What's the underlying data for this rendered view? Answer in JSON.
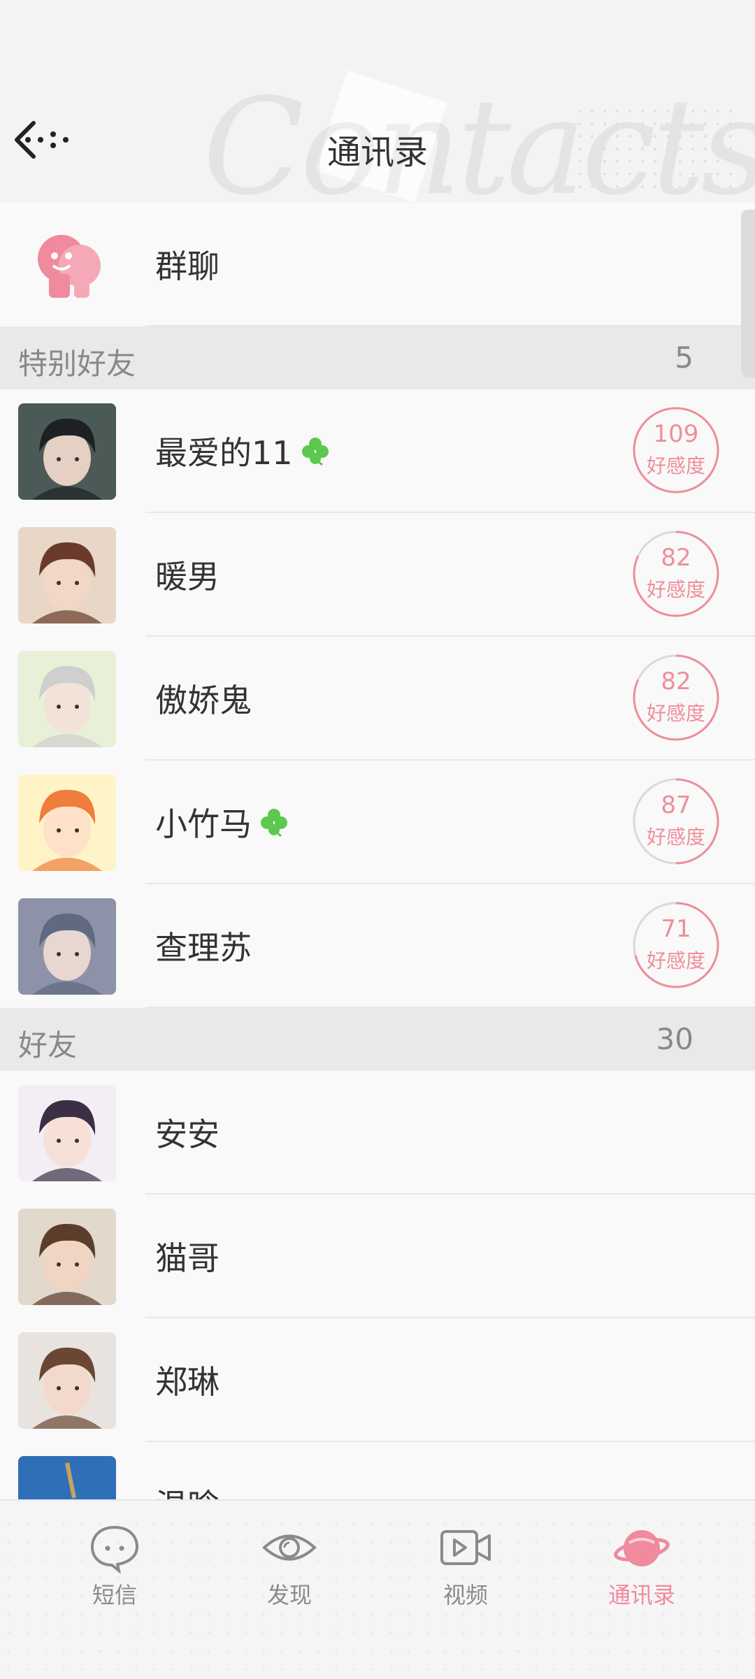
{
  "header": {
    "title": "通讯录",
    "background_word": "Contacts"
  },
  "group_chat": {
    "label": "群聊"
  },
  "special_friends": {
    "title": "特别好友",
    "count": "5",
    "items": [
      {
        "name": "最爱的11",
        "clover": true,
        "affinity": "109",
        "affinity_label": "好感度",
        "fraction": 1.0,
        "avatar": "avatar-dark-hair-man"
      },
      {
        "name": "暖男",
        "clover": false,
        "affinity": "82",
        "affinity_label": "好感度",
        "fraction": 0.82,
        "avatar": "avatar-glasses-man"
      },
      {
        "name": "傲娇鬼",
        "clover": false,
        "affinity": "82",
        "affinity_label": "好感度",
        "fraction": 0.82,
        "avatar": "avatar-silver-hair-man"
      },
      {
        "name": "小竹马",
        "clover": true,
        "affinity": "87",
        "affinity_label": "好感度",
        "fraction": 0.5,
        "avatar": "avatar-chibi-boy"
      },
      {
        "name": "查理苏",
        "clover": false,
        "affinity": "71",
        "affinity_label": "好感度",
        "fraction": 0.71,
        "avatar": "avatar-sunglasses-man"
      }
    ]
  },
  "friends": {
    "title": "好友",
    "count": "30",
    "items": [
      {
        "name": "安安",
        "avatar": "avatar-purple-hair-girl"
      },
      {
        "name": "猫哥",
        "avatar": "avatar-brown-hair-man"
      },
      {
        "name": "郑琳",
        "avatar": "avatar-glasses-woman"
      },
      {
        "name": "温晗",
        "avatar": "avatar-sky-photo"
      }
    ]
  },
  "tabbar": {
    "tabs": [
      {
        "label": "短信",
        "icon": "chat-bubble-icon",
        "active": false
      },
      {
        "label": "发现",
        "icon": "eye-icon",
        "active": false
      },
      {
        "label": "视频",
        "icon": "video-icon",
        "active": false
      },
      {
        "label": "通讯录",
        "icon": "planet-icon",
        "active": true
      }
    ]
  },
  "colors": {
    "accent_pink": "#f08a9c",
    "section_bg": "#e9e9e9",
    "clover_green": "#5cc84f"
  }
}
